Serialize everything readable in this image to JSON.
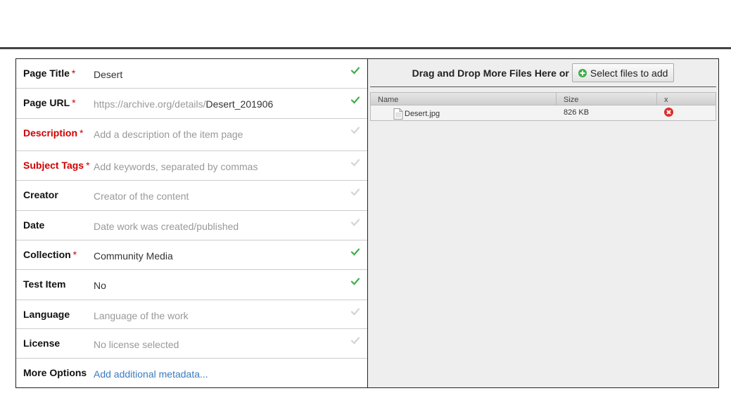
{
  "metadata": {
    "rows": [
      {
        "label": "Page Title",
        "required": true,
        "label_red": false,
        "value": "Desert",
        "value_type": "text",
        "checked": true
      },
      {
        "label": "Page URL",
        "required": true,
        "label_red": false,
        "value_prefix": "https://archive.org/details/",
        "value": "Desert_201906",
        "value_type": "url",
        "checked": true
      },
      {
        "label": "Description",
        "required": true,
        "label_red": true,
        "value": "Add a description of the item page",
        "value_type": "placeholder",
        "checked": false
      },
      {
        "label": "Subject Tags",
        "required": true,
        "label_red": true,
        "value": "Add keywords, separated by commas",
        "value_type": "placeholder",
        "checked": false
      },
      {
        "label": "Creator",
        "required": false,
        "label_red": false,
        "value": "Creator of the content",
        "value_type": "placeholder",
        "checked": false
      },
      {
        "label": "Date",
        "required": false,
        "label_red": false,
        "value": "Date work was created/published",
        "value_type": "placeholder",
        "checked": false
      },
      {
        "label": "Collection",
        "required": true,
        "label_red": false,
        "value": "Community Media",
        "value_type": "text",
        "checked": true
      },
      {
        "label": "Test Item",
        "required": false,
        "label_red": false,
        "value": "No",
        "value_type": "text",
        "checked": true
      },
      {
        "label": "Language",
        "required": false,
        "label_red": false,
        "value": "Language of the work",
        "value_type": "placeholder",
        "checked": false
      },
      {
        "label": "License",
        "required": false,
        "label_red": false,
        "value": "No license selected",
        "value_type": "placeholder",
        "checked": false
      },
      {
        "label": "More Options",
        "required": false,
        "label_red": false,
        "value": "Add additional metadata...",
        "value_type": "link",
        "checked": null
      }
    ],
    "required_marker": "*"
  },
  "files": {
    "drop_text": "Drag and Drop More Files Here or",
    "select_button_label": "Select files to add",
    "columns": {
      "name": "Name",
      "size": "Size",
      "remove": "x"
    },
    "items": [
      {
        "name": "Desert.jpg",
        "size": "826 KB"
      }
    ]
  },
  "colors": {
    "check_active": "#3fae49",
    "check_inactive": "#d4d4d4",
    "required_red": "#d00000",
    "link_blue": "#3a7bc0",
    "remove_red": "#d9302c",
    "add_green": "#3fae49"
  }
}
